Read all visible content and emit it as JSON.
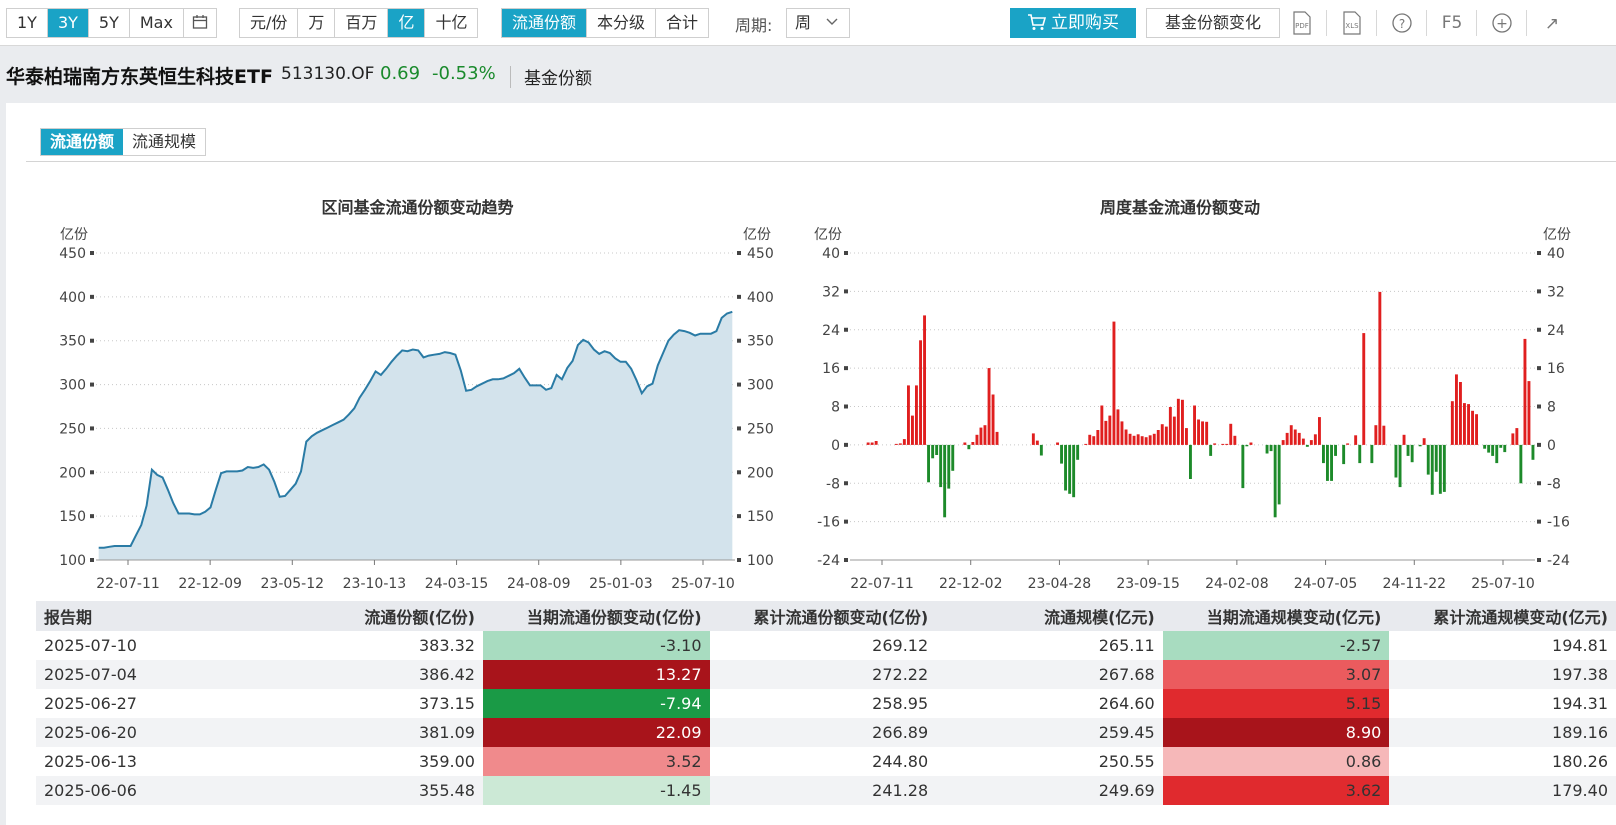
{
  "toolbar": {
    "range_buttons": [
      "1Y",
      "3Y",
      "5Y",
      "Max"
    ],
    "range_active": "3Y",
    "unit_buttons": [
      "元/份",
      "万",
      "百万",
      "亿",
      "十亿"
    ],
    "unit_active": "亿",
    "view_buttons": [
      "流通份额",
      "本分级",
      "合计"
    ],
    "view_active": "流通份额",
    "period_label": "周期:",
    "period_value": "周",
    "buy_label": "立即购买",
    "share_change_label": "基金份额变化",
    "pdf_label": "PDF",
    "xls_label": "XLS",
    "help_label": "?",
    "f5_label": "F5",
    "add_label": "+",
    "share_label": "↗"
  },
  "header": {
    "fund_name": "华泰柏瑞南方东英恒生科技ETF",
    "fund_code": "513130.OF",
    "nav": "0.69",
    "change": "-0.53%",
    "section": "基金份额"
  },
  "subtabs": [
    "流通份额",
    "流通规模"
  ],
  "subtab_active": "流通份额",
  "colors": {
    "accent": "#1aa3c6",
    "line": "#2a7ba5",
    "area": "#d3e3ec",
    "up": "#e01f1f",
    "down": "#1d8a2a"
  },
  "chart_data": [
    {
      "type": "area",
      "title": "区间基金流通份额变动趋势",
      "ylabel": "亿份",
      "ylim": [
        100,
        450
      ],
      "yticks": [
        100,
        150,
        200,
        250,
        300,
        350,
        400,
        450
      ],
      "xtick_labels": [
        "22-07-11",
        "22-12-09",
        "23-05-12",
        "23-10-13",
        "24-03-15",
        "24-08-09",
        "25-01-03",
        "25-07-10"
      ],
      "grid": true,
      "values": [
        114,
        114,
        115,
        116,
        116,
        116,
        116,
        128,
        140,
        162,
        203,
        197,
        194,
        180,
        165,
        153,
        153,
        153,
        152,
        152,
        155,
        160,
        180,
        199,
        201,
        201,
        201,
        202,
        206,
        205,
        206,
        209,
        203,
        189,
        172,
        173,
        180,
        187,
        201,
        235,
        241,
        245,
        248,
        251,
        254,
        257,
        260,
        266,
        273,
        285,
        294,
        304,
        315,
        311,
        318,
        326,
        333,
        339,
        338,
        340,
        339,
        331,
        333,
        334,
        335,
        337,
        336,
        334,
        316,
        293,
        294,
        298,
        301,
        304,
        306,
        306,
        307,
        310,
        313,
        318,
        308,
        299,
        299,
        299,
        294,
        296,
        311,
        306,
        319,
        327,
        345,
        351,
        348,
        340,
        335,
        338,
        336,
        330,
        326,
        326,
        318,
        305,
        290,
        298,
        301,
        322,
        336,
        350,
        357,
        362,
        361,
        359,
        356,
        358,
        358,
        358,
        361,
        376,
        381,
        383
      ]
    },
    {
      "type": "bar",
      "title": "周度基金流通份额变动",
      "ylabel": "亿份",
      "ylim": [
        -24,
        40
      ],
      "yticks": [
        -24,
        -16,
        -8,
        0,
        8,
        16,
        24,
        32,
        40
      ],
      "xtick_labels": [
        "22-07-11",
        "22-12-02",
        "23-04-28",
        "23-09-15",
        "24-02-08",
        "24-07-05",
        "24-11-22",
        "25-07-10"
      ],
      "grid": true,
      "values": [
        0,
        0,
        0,
        0,
        0.5,
        0.5,
        0.8,
        0,
        0,
        0,
        0,
        0.2,
        0.3,
        1.2,
        12.4,
        6.1,
        12.4,
        21.8,
        27.0,
        -7.8,
        -2.8,
        -2.1,
        -8.8,
        -15.1,
        -9.1,
        -5.4,
        0,
        0,
        0.5,
        -0.9,
        0.6,
        2.1,
        3.6,
        4.1,
        16.0,
        10.5,
        2.7,
        0,
        0,
        0,
        0,
        0,
        0,
        0,
        0,
        2.4,
        0.9,
        -2.2,
        0,
        0,
        0,
        0.5,
        -3.9,
        -9.5,
        -10.2,
        -10.9,
        -3.1,
        0,
        0.2,
        2.1,
        1.8,
        3.1,
        8.2,
        5.0,
        6.1,
        25.7,
        7.4,
        4.9,
        3.2,
        2.3,
        1.9,
        2.2,
        1.8,
        1.6,
        2.0,
        2.3,
        3.1,
        4.3,
        3.8,
        7.9,
        5.9,
        9.6,
        9.4,
        3.5,
        -7.1,
        8.2,
        5.3,
        4.9,
        4.8,
        -2.3,
        0.3,
        0,
        0.2,
        0.2,
        4.4,
        1.9,
        0,
        -9.0,
        -0.3,
        0.5,
        0,
        0,
        0,
        -1.8,
        -1.3,
        -15.1,
        -12.4,
        1.0,
        2.5,
        4.1,
        3.2,
        2.5,
        1.3,
        -0.4,
        1.0,
        2.2,
        5.8,
        -3.8,
        -7.5,
        -7.5,
        -2.3,
        0,
        -4.0,
        0.3,
        0,
        2.0,
        -3.8,
        23.3,
        0,
        -3.8,
        4.1,
        31.9,
        4.0,
        0,
        0,
        -6.8,
        -8.8,
        2.1,
        -2.3,
        -3.6,
        0,
        -0.3,
        1.4,
        -6.2,
        -10.4,
        -5.6,
        -10.2,
        -9.8,
        0,
        9.1,
        14.7,
        13.1,
        8.7,
        8.5,
        7.1,
        6.4,
        0,
        -0.8,
        -1.6,
        -2.3,
        -3.8,
        -0.6,
        -1.5,
        0,
        2.4,
        3.5,
        -8.0,
        22.1,
        13.3,
        -3.1
      ]
    }
  ],
  "table": {
    "headers": [
      "报告期",
      "流通份额(亿份)",
      "当期流通份额变动(亿份)",
      "累计流通份额变动(亿份)",
      "流通规模(亿元)",
      "当期流通规模变动(亿元)",
      "累计流通规模变动(亿元)"
    ],
    "rows": [
      [
        "2025-07-10",
        "383.32",
        "-3.10",
        "269.12",
        "265.11",
        "-2.57",
        "194.81"
      ],
      [
        "2025-07-04",
        "386.42",
        "13.27",
        "272.22",
        "267.68",
        "3.07",
        "197.38"
      ],
      [
        "2025-06-27",
        "373.15",
        "-7.94",
        "258.95",
        "264.60",
        "5.15",
        "194.31"
      ],
      [
        "2025-06-20",
        "381.09",
        "22.09",
        "266.89",
        "259.45",
        "8.90",
        "189.16"
      ],
      [
        "2025-06-13",
        "359.00",
        "3.52",
        "244.80",
        "250.55",
        "0.86",
        "180.26"
      ],
      [
        "2025-06-06",
        "355.48",
        "-1.45",
        "241.28",
        "249.69",
        "3.62",
        "179.40"
      ]
    ],
    "share_change_colors": [
      "#a8dcc0",
      "#a8141b",
      "#1a9a46",
      "#a8141b",
      "#f08a8c",
      "#cce9d6"
    ],
    "share_change_text_colors": [
      "#333333",
      "#ffffff",
      "#ffffff",
      "#ffffff",
      "#333333",
      "#333333"
    ],
    "scale_change_colors": [
      "#a8dcc0",
      "#eb5b5e",
      "#e02a2e",
      "#a8141b",
      "#f6b8b9",
      "#e02a2e"
    ],
    "scale_change_text_colors": [
      "#333333",
      "#333333",
      "#333333",
      "#ffffff",
      "#333333",
      "#333333"
    ]
  }
}
